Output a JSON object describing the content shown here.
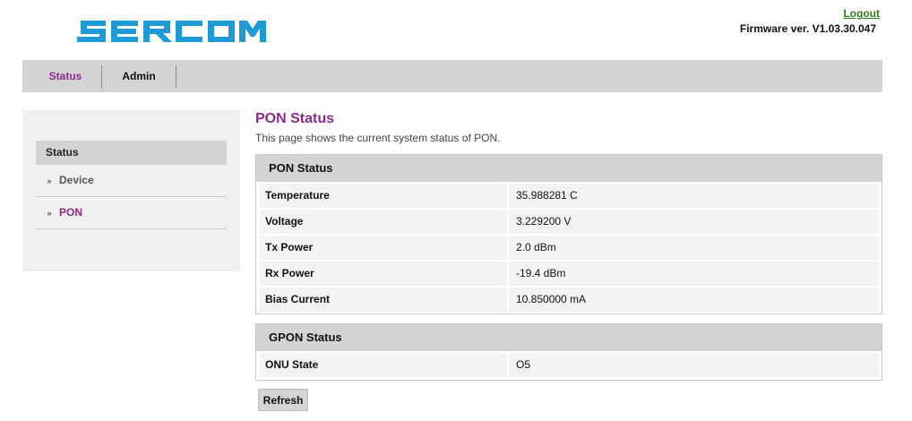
{
  "header": {
    "logo_text": "SERCOM",
    "logout_label": "Logout",
    "firmware": "Firmware ver. V1.03.30.047",
    "brand_color": "#1e9bd7",
    "accent_color": "#8b2a8b"
  },
  "nav": {
    "tabs": [
      {
        "label": "Status",
        "active": true
      },
      {
        "label": "Admin",
        "active": false
      }
    ]
  },
  "sidebar": {
    "heading": "Status",
    "items": [
      {
        "label": "Device",
        "active": false,
        "icon": "double-chevron-right-icon"
      },
      {
        "label": "PON",
        "active": true,
        "icon": "double-chevron-right-icon"
      }
    ]
  },
  "main": {
    "title": "PON Status",
    "description": "This page shows the current system status of PON.",
    "pon_panel": {
      "heading": "PON Status",
      "rows": [
        {
          "label": "Temperature",
          "value": "35.988281 C"
        },
        {
          "label": "Voltage",
          "value": "3.229200 V"
        },
        {
          "label": "Tx Power",
          "value": "2.0 dBm"
        },
        {
          "label": "Rx Power",
          "value": "-19.4 dBm"
        },
        {
          "label": "Bias Current",
          "value": "10.850000 mA"
        }
      ]
    },
    "gpon_panel": {
      "heading": "GPON Status",
      "rows": [
        {
          "label": "ONU State",
          "value": "O5"
        }
      ]
    },
    "refresh_label": "Refresh"
  }
}
